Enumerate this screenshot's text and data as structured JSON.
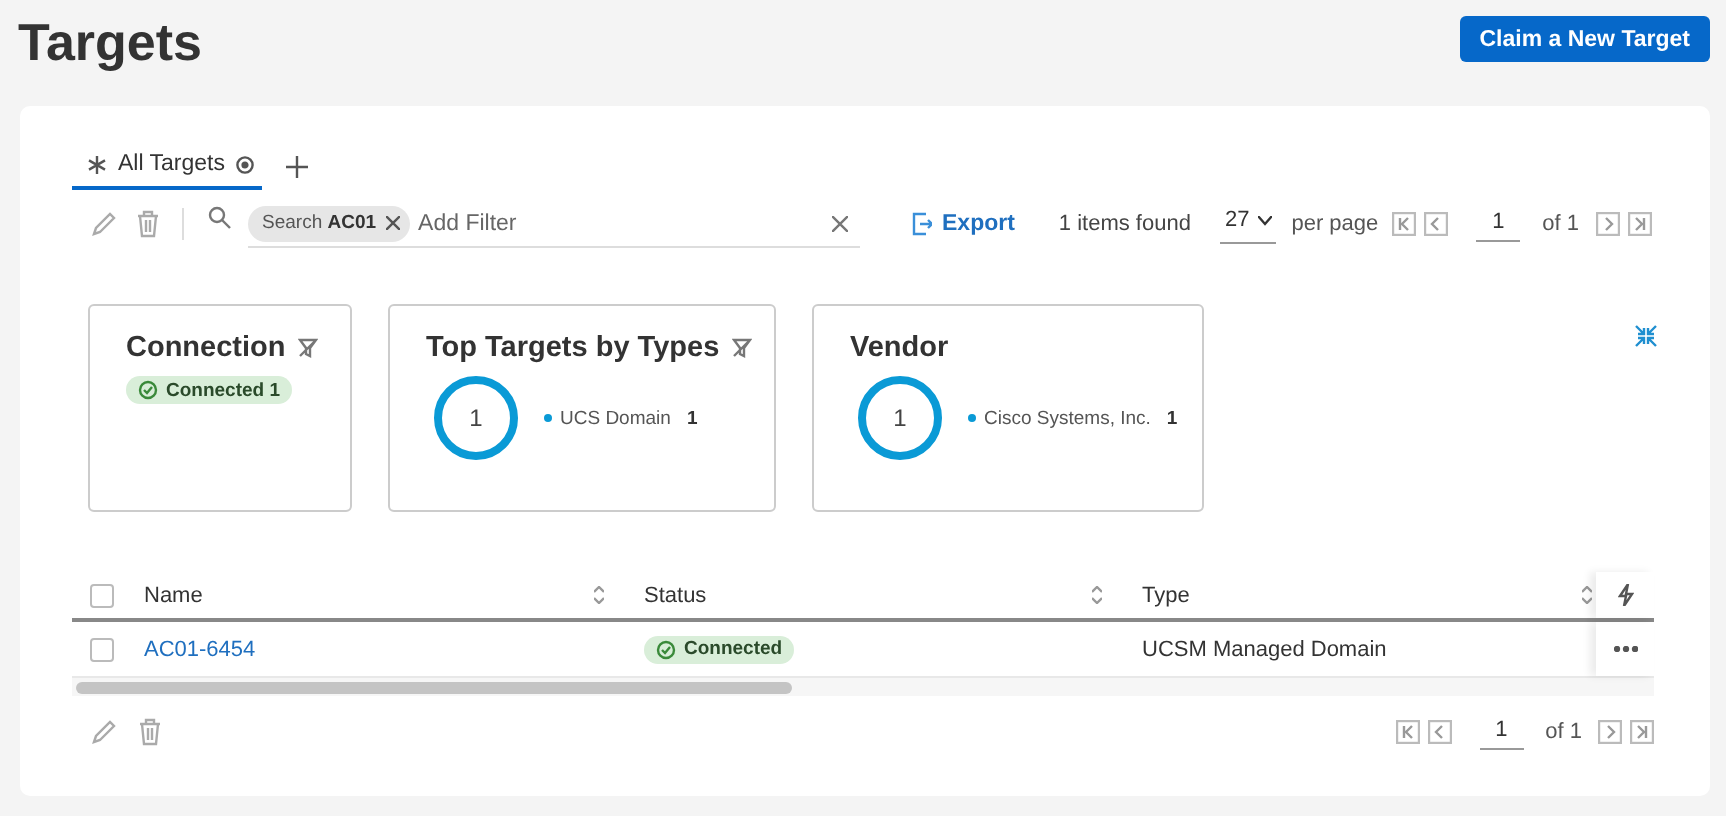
{
  "page": {
    "title": "Targets",
    "primary_button": "Claim a New Target"
  },
  "tabs": [
    {
      "label": "All Targets",
      "selected": true
    }
  ],
  "toolbar": {
    "filter_chip": {
      "label": "Search",
      "value": "AC01"
    },
    "placeholder": "Add Filter",
    "export": "Export",
    "items_found": "1 items found",
    "per_page": "27",
    "per_page_label": "per page",
    "page": "1",
    "of_pages": "of 1"
  },
  "widgets": [
    {
      "title": "Connection",
      "filterable": true,
      "kind": "badges",
      "badges": [
        "Connected 1"
      ]
    },
    {
      "title": "Top Targets by Types",
      "filterable": true,
      "kind": "donut",
      "total": "1",
      "legend": [
        {
          "label": "UCS Domain",
          "count": "1"
        }
      ]
    },
    {
      "title": "Vendor",
      "filterable": false,
      "kind": "donut",
      "total": "1",
      "legend": [
        {
          "label": "Cisco Systems, Inc.",
          "count": "1"
        }
      ]
    }
  ],
  "table": {
    "columns": [
      "Name",
      "Status",
      "Type"
    ],
    "header_checked": false,
    "rows": [
      {
        "checked": false,
        "name": "AC01-6454",
        "status": "Connected",
        "type": "UCSM Managed Domain"
      }
    ]
  },
  "footer": {
    "page": "1",
    "of_pages": "of 1"
  }
}
